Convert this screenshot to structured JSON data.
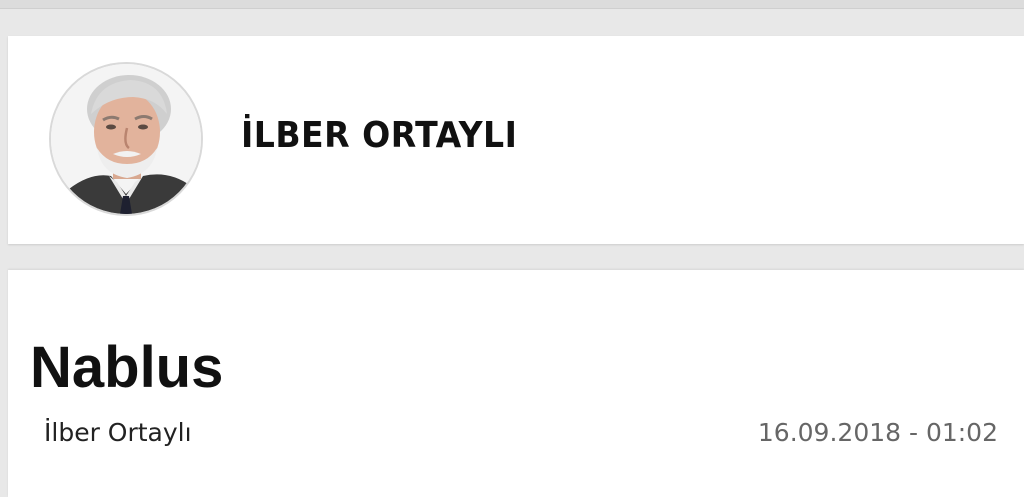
{
  "author": {
    "name": "İLBER ORTAYLI",
    "avatar_icon": "author-portrait"
  },
  "article": {
    "title": "Nablus",
    "byline": "İlber Ortaylı",
    "datetime": "16.09.2018 - 01:02"
  },
  "colors": {
    "page_background": "#e8e8e8",
    "card_background": "#ffffff",
    "title_text": "#111111",
    "date_text": "#666666"
  }
}
